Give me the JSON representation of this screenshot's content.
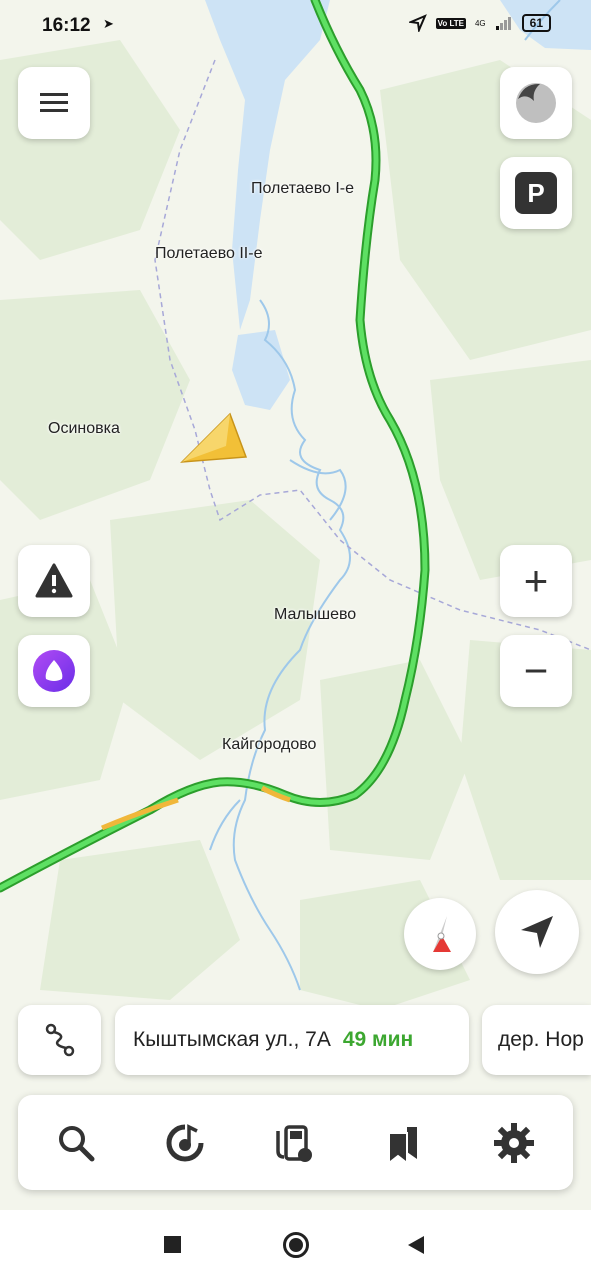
{
  "status_bar": {
    "time": "16:12",
    "lte_badge": "Vo LTE",
    "network": "4G",
    "battery": "61"
  },
  "map": {
    "places": [
      {
        "name": "Полетаево I-е"
      },
      {
        "name": "Полетаево II-е"
      },
      {
        "name": "Осиновка"
      },
      {
        "name": "Малышево"
      },
      {
        "name": "Кайгородово"
      }
    ],
    "colors": {
      "land": "#f3f5ec",
      "forest": "#e2ecd6",
      "water": "#cde3f5",
      "route": "#4fd25a",
      "traffic_slow": "#f0b73a",
      "user_arrow": "#f2c037"
    }
  },
  "controls": {
    "menu": "hamburger-menu",
    "parking_label": "P",
    "zoom_in": "+",
    "zoom_out": "−"
  },
  "route_cards": [
    {
      "address": "Кыштымская ул., 7А",
      "eta": "49 мин"
    },
    {
      "address": "дер. Нор",
      "eta": ""
    }
  ],
  "toolbar": {
    "icons": [
      "search-icon",
      "music-icon",
      "gas-station-icon",
      "bookmarks-icon",
      "settings-icon"
    ]
  },
  "system_nav": [
    "recents",
    "home",
    "back"
  ]
}
